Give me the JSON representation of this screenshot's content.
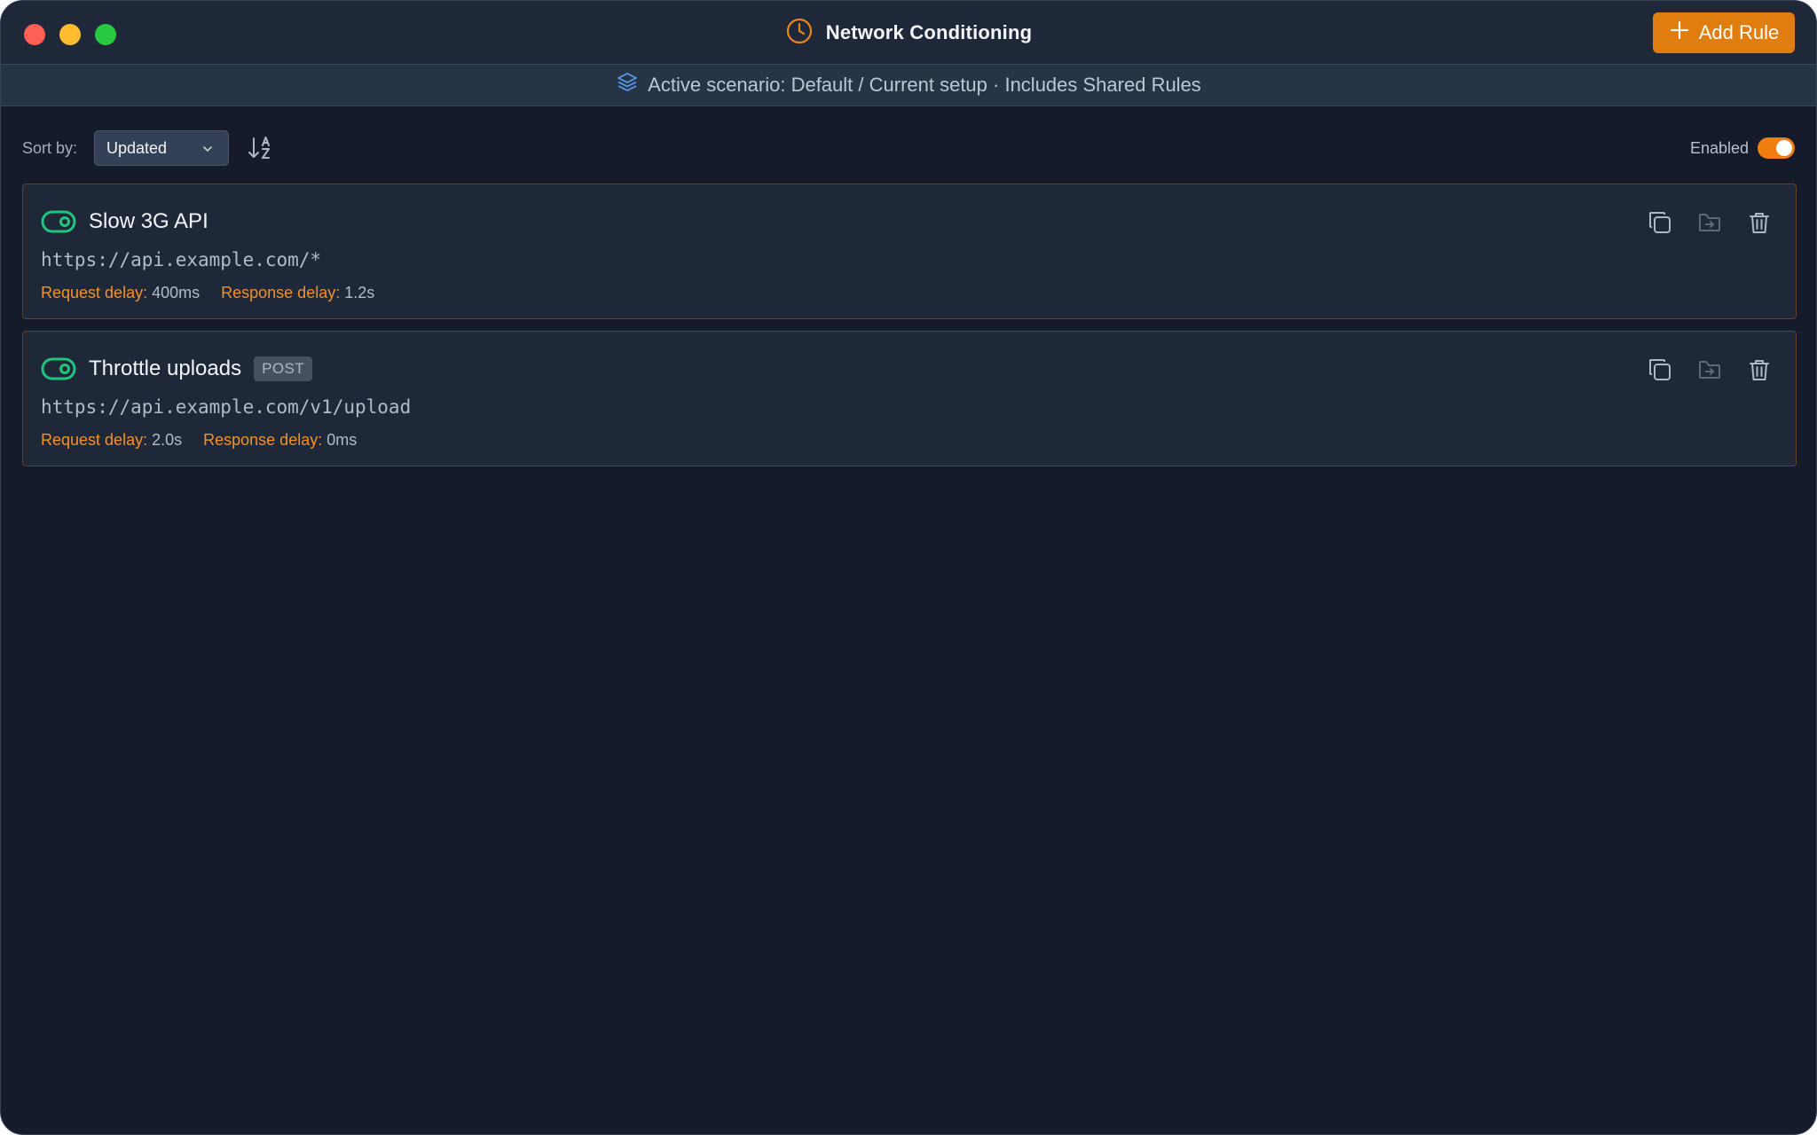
{
  "window": {
    "title": "Network Conditioning",
    "add_rule_label": "Add Rule"
  },
  "scenario": {
    "text": "Active scenario: Default / Current setup · Includes Shared Rules"
  },
  "toolbar": {
    "sort_label": "Sort by:",
    "sort_value": "Updated",
    "enabled_label": "Enabled",
    "enabled": true
  },
  "rules": [
    {
      "name": "Slow 3G API",
      "method": "",
      "url": "https://api.example.com/*",
      "enabled": true,
      "request_delay_label": "Request delay:",
      "request_delay": "400ms",
      "response_delay_label": "Response delay:",
      "response_delay": "1.2s"
    },
    {
      "name": "Throttle uploads",
      "method": "POST",
      "url": "https://api.example.com/v1/upload",
      "enabled": true,
      "request_delay_label": "Request delay:",
      "request_delay": "2.0s",
      "response_delay_label": "Response delay:",
      "response_delay": "0ms"
    }
  ],
  "icons": {
    "title": "clock-icon",
    "add": "plus-icon",
    "scenario": "layers-icon",
    "sort_dropdown": "chevron-down-icon",
    "sort_direction": "sort-alpha-icon",
    "rule_toggle": "toggle-on-icon",
    "duplicate": "copy-icon",
    "move": "folder-move-icon",
    "delete": "trash-icon"
  },
  "colors": {
    "window_bg": "#151b2b",
    "titlebar_bg": "#1e2838",
    "accent": "#e17c0f",
    "rule_enabled": "#20c57b",
    "delay_label": "#f5912a",
    "card_border": "#6b3d21"
  }
}
